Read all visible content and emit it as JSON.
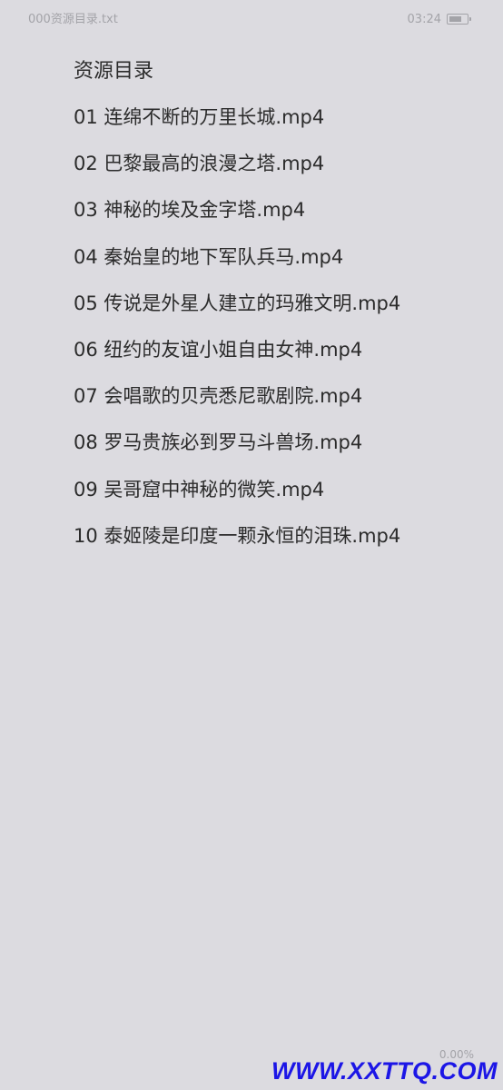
{
  "status_bar": {
    "file_name": "000资源目录.txt",
    "time": "03:24",
    "battery_level": 0.75
  },
  "document": {
    "title": "资源目录",
    "items": [
      "01 连绵不断的万里长城.mp4",
      "02 巴黎最高的浪漫之塔.mp4",
      "03 神秘的埃及金字塔.mp4",
      "04 秦始皇的地下军队兵马.mp4",
      "05 传说是外星人建立的玛雅文明.mp4",
      "06 纽约的友谊小姐自由女神.mp4",
      "07 会唱歌的贝壳悉尼歌剧院.mp4",
      "08 罗马贵族必到罗马斗兽场.mp4",
      "09 吴哥窟中神秘的微笑.mp4",
      "10 泰姬陵是印度一颗永恒的泪珠.mp4"
    ]
  },
  "progress_text": "0.00%",
  "watermark": "WWW.XXTTQ.COM"
}
